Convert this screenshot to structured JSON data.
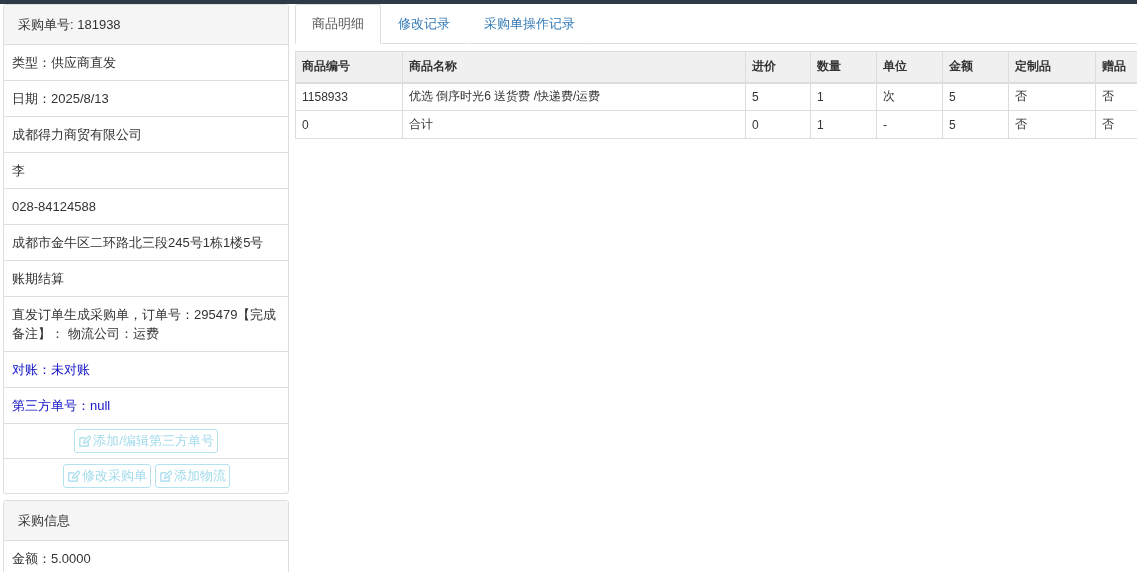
{
  "order_panel": {
    "title": "采购单号: 181938",
    "items": [
      {
        "text": "类型：供应商直发",
        "kind": "text"
      },
      {
        "text": "日期：2025/8/13",
        "kind": "text"
      },
      {
        "text": "成都得力商贸有限公司",
        "kind": "text"
      },
      {
        "text": "李",
        "kind": "text"
      },
      {
        "text": "028-84124588",
        "kind": "text"
      },
      {
        "text": "成都市金牛区二环路北三段245号1栋1楼5号",
        "kind": "text"
      },
      {
        "text": "账期结算",
        "kind": "text"
      },
      {
        "text": "直发订单生成采购单，订单号：295479【完成备注】： 物流公司：运费",
        "kind": "text"
      },
      {
        "text": "对账：未对账",
        "kind": "link"
      },
      {
        "text": "第三方单号：null",
        "kind": "link"
      }
    ],
    "action_rows": [
      [
        {
          "label": "添加/编辑第三方单号",
          "disabled": true
        }
      ],
      [
        {
          "label": "修改采购单",
          "disabled": true
        },
        {
          "label": "添加物流",
          "disabled": true
        }
      ]
    ]
  },
  "info_panel": {
    "title": "采购信息",
    "items": [
      {
        "text": "金额：5.0000",
        "kind": "text"
      }
    ]
  },
  "tabs": [
    {
      "label": "商品明细",
      "selected": true
    },
    {
      "label": "修改记录",
      "selected": false
    },
    {
      "label": "采购单操作记录",
      "selected": false
    }
  ],
  "table": {
    "columns": [
      "商品编号",
      "商品名称",
      "进价",
      "数量",
      "单位",
      "金额",
      "定制品",
      "赠品"
    ],
    "rows": [
      [
        "1158933",
        "优选 倒序时光6 送货费 /快递费/运费",
        "5",
        "1",
        "次",
        "5",
        "否",
        "否"
      ],
      [
        "0",
        "合计",
        "0",
        "1",
        "-",
        "5",
        "否",
        "否"
      ]
    ]
  }
}
